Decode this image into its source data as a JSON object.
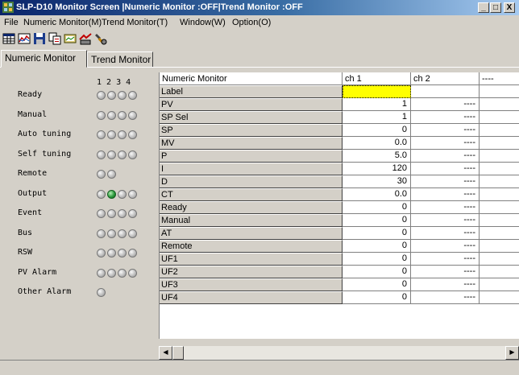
{
  "window": {
    "title": "SLP-D10 Monitor Screen |Numeric Monitor :OFF|Trend Monitor :OFF",
    "min_label": "_",
    "max_label": "□",
    "close_label": "X"
  },
  "menu": {
    "items": [
      "File",
      "Numeric Monitor(M)",
      "Trend Monitor(T)",
      "Window(W)",
      "Option(O)"
    ]
  },
  "toolbar": {
    "icons": [
      "grid-view-icon",
      "trend-chart-icon",
      "save-icon",
      "copy-icon",
      "monitor-icon",
      "comms-icon",
      "settings-icon"
    ]
  },
  "tabs": [
    {
      "label": "Numeric Monitor",
      "active": true
    },
    {
      "label": "Trend Monitor",
      "active": false
    }
  ],
  "status_panel": {
    "channel_header": "1 2 3 4",
    "rows": [
      {
        "label": "Ready",
        "leds": [
          0,
          0,
          0,
          0
        ]
      },
      {
        "label": "Manual",
        "leds": [
          0,
          0,
          0,
          0
        ]
      },
      {
        "label": "Auto tuning",
        "leds": [
          0,
          0,
          0,
          0
        ]
      },
      {
        "label": "Self tuning",
        "leds": [
          0,
          0,
          0,
          0
        ]
      },
      {
        "label": "Remote",
        "leds": [
          0,
          0
        ]
      },
      {
        "label": "Output",
        "leds": [
          0,
          1,
          0,
          0
        ]
      },
      {
        "label": "Event",
        "leds": [
          0,
          0,
          0,
          0
        ]
      },
      {
        "label": "Bus",
        "leds": [
          0,
          0,
          0,
          0
        ]
      },
      {
        "label": "RSW",
        "leds": [
          0,
          0,
          0,
          0
        ]
      },
      {
        "label": "PV Alarm",
        "leds": [
          0,
          0,
          0,
          0
        ]
      },
      {
        "label": "Other Alarm",
        "leds": [
          0
        ]
      }
    ]
  },
  "grid": {
    "headers": [
      "Numeric Monitor",
      "ch 1",
      "ch 2",
      "----"
    ],
    "rows": [
      {
        "label": "Label",
        "ch1": "",
        "ch2": "",
        "ch3": ""
      },
      {
        "label": "PV",
        "ch1": "1",
        "ch2": "----",
        "ch3": ""
      },
      {
        "label": "SP Sel",
        "ch1": "1",
        "ch2": "----",
        "ch3": ""
      },
      {
        "label": "SP",
        "ch1": "0",
        "ch2": "----",
        "ch3": ""
      },
      {
        "label": "MV",
        "ch1": "0.0",
        "ch2": "----",
        "ch3": ""
      },
      {
        "label": "P",
        "ch1": "5.0",
        "ch2": "----",
        "ch3": ""
      },
      {
        "label": "I",
        "ch1": "120",
        "ch2": "----",
        "ch3": ""
      },
      {
        "label": "D",
        "ch1": "30",
        "ch2": "----",
        "ch3": ""
      },
      {
        "label": "CT",
        "ch1": "0.0",
        "ch2": "----",
        "ch3": ""
      },
      {
        "label": "Ready",
        "ch1": "0",
        "ch2": "----",
        "ch3": ""
      },
      {
        "label": "Manual",
        "ch1": "0",
        "ch2": "----",
        "ch3": ""
      },
      {
        "label": "AT",
        "ch1": "0",
        "ch2": "----",
        "ch3": ""
      },
      {
        "label": "Remote",
        "ch1": "0",
        "ch2": "----",
        "ch3": ""
      },
      {
        "label": "UF1",
        "ch1": "0",
        "ch2": "----",
        "ch3": ""
      },
      {
        "label": "UF2",
        "ch1": "0",
        "ch2": "----",
        "ch3": ""
      },
      {
        "label": "UF3",
        "ch1": "0",
        "ch2": "----",
        "ch3": ""
      },
      {
        "label": "UF4",
        "ch1": "0",
        "ch2": "----",
        "ch3": ""
      }
    ]
  },
  "colors": {
    "selected_cell": "#ffff00",
    "led_on": "#2c9a3c",
    "led_off": "#b8b8b8"
  }
}
